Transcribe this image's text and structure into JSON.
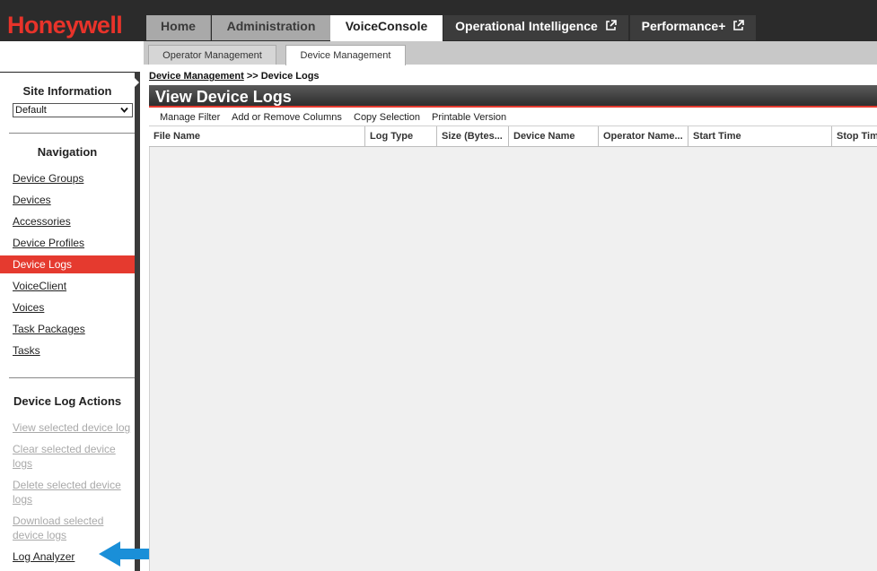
{
  "header": {
    "logo": "Honeywell",
    "tabs": [
      {
        "label": "Home"
      },
      {
        "label": "Administration"
      },
      {
        "label": "VoiceConsole"
      },
      {
        "label": "Operational Intelligence"
      },
      {
        "label": "Performance+"
      }
    ]
  },
  "subtabs": [
    {
      "label": "Operator Management"
    },
    {
      "label": "Device Management"
    }
  ],
  "sidebar": {
    "site_title": "Site Information",
    "site_value": "Default",
    "nav_title": "Navigation",
    "nav_items": [
      {
        "label": "Device Groups"
      },
      {
        "label": "Devices"
      },
      {
        "label": "Accessories"
      },
      {
        "label": "Device Profiles"
      },
      {
        "label": "Device Logs"
      },
      {
        "label": "VoiceClient"
      },
      {
        "label": "Voices"
      },
      {
        "label": "Task Packages"
      },
      {
        "label": "Tasks"
      }
    ],
    "actions_title": "Device Log Actions",
    "actions": [
      {
        "label": "View selected device log"
      },
      {
        "label": "Clear selected device logs"
      },
      {
        "label": "Delete selected device logs"
      },
      {
        "label": "Download selected device logs"
      },
      {
        "label": "Log Analyzer"
      }
    ]
  },
  "main": {
    "breadcrumb_link": "Device Management",
    "breadcrumb_sep": " >> ",
    "breadcrumb_current": "Device Logs",
    "title": "View Device Logs",
    "toolbar": [
      "Manage Filter",
      "Add or Remove Columns",
      "Copy Selection",
      "Printable Version"
    ],
    "columns": [
      "File Name",
      "Log Type",
      "Size (Bytes...",
      "Device Name",
      "Operator Name...",
      "Start Time",
      "Stop Time"
    ]
  },
  "colors": {
    "brand_red": "#e53a2f",
    "arrow_blue": "#1a8fd8",
    "header_dark": "#2b2b2b"
  }
}
